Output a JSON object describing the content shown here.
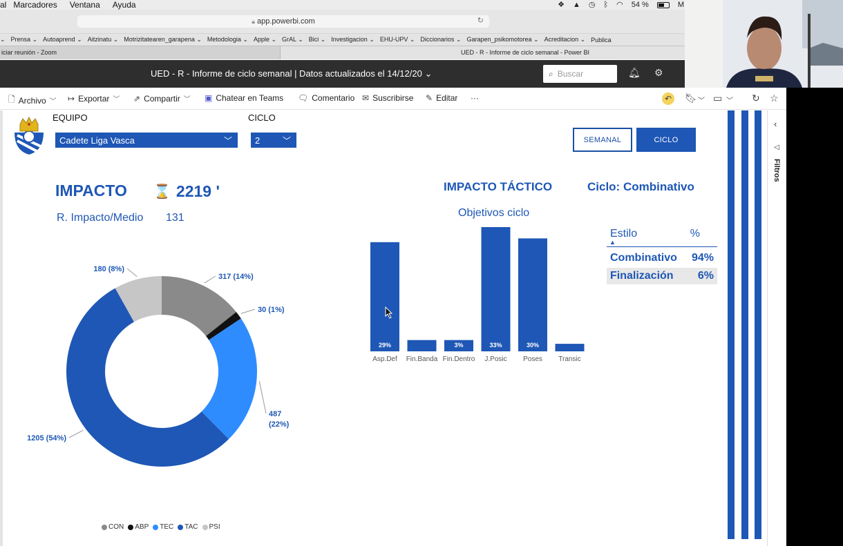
{
  "menubar": {
    "items": [
      "al",
      "Marcadores",
      "Ventana",
      "Ayuda"
    ],
    "battery": "54 %",
    "clock": "M"
  },
  "browser": {
    "url": "app.powerbi.com",
    "bookmarks": [
      "Prensa ⌄",
      "Autoaprend ⌄",
      "Aitzinatu ⌄",
      "Motrizitatearen_garapena ⌄",
      "Metodologia ⌄",
      "Apple ⌄",
      "GrAL ⌄",
      "Bici ⌄",
      "Investigacion ⌄",
      "EHU-UPV ⌄",
      "Diccionarios ⌄",
      "Garapen_psikomotorea ⌄",
      "Acreditacion ⌄",
      "Publica"
    ],
    "tabs": [
      "iciar reunión - Zoom",
      "UED - R - Informe de ciclo semanal - Power BI"
    ]
  },
  "header": {
    "title": "UED - R - Informe de ciclo semanal  |  Datos actualizados el 14/12/20  ⌄",
    "search_placeholder": "Buscar"
  },
  "toolbar": {
    "archivo": "Archivo",
    "exportar": "Exportar",
    "compartir": "Compartir",
    "chatear": "Chatear en Teams",
    "comentario": "Comentario",
    "suscribirse": "Suscribirse",
    "editar": "Editar",
    "more": "···"
  },
  "filters_label": "Filtros",
  "report": {
    "equipo_label": "EQUIPO",
    "equipo_value": "Cadete Liga Vasca",
    "ciclo_label": "CICLO",
    "ciclo_value": "2",
    "btn_semanal": "SEMANAL",
    "btn_ciclo": "CICLO",
    "impacto_label": "IMPACTO",
    "impacto_value": "2219 '",
    "impacto_medio_label": "R. Impacto/Medio",
    "impacto_medio_value": "131",
    "tactico_label": "IMPACTO TÁCTICO",
    "ciclo_tipo": "Ciclo: Combinativo",
    "objetivos_title": "Objetivos ciclo",
    "estilo_header": "Estilo",
    "pct_header": "%",
    "estilo_rows": [
      {
        "name": "Combinativo",
        "value": "94%"
      },
      {
        "name": "Finalización",
        "value": "6%"
      }
    ]
  },
  "chart_data": [
    {
      "type": "pie",
      "labels": [
        "CON",
        "ABP",
        "TEC",
        "TAC",
        "PSI"
      ],
      "values": [
        317,
        30,
        487,
        1205,
        180
      ],
      "data_labels": [
        "317 (14%)",
        "30 (1%)",
        "487 (22%)",
        "1205 (54%)",
        "180 (8%)"
      ],
      "colors": [
        "#8a8a8a",
        "#111111",
        "#2f8cff",
        "#1e57b5",
        "#c6c6c6"
      ],
      "legend_position": "bottom",
      "donut": true
    },
    {
      "type": "bar",
      "title": "Objetivos ciclo",
      "categories": [
        "Asp.Def",
        "Fin.Banda",
        "Fin.Dentro",
        "J.Posic",
        "Poses",
        "Transic"
      ],
      "values": [
        29,
        3,
        3,
        33,
        30,
        2
      ],
      "data_labels": [
        "29%",
        "",
        "3%",
        "33%",
        "30%",
        ""
      ],
      "color": "#1e57b5"
    }
  ]
}
